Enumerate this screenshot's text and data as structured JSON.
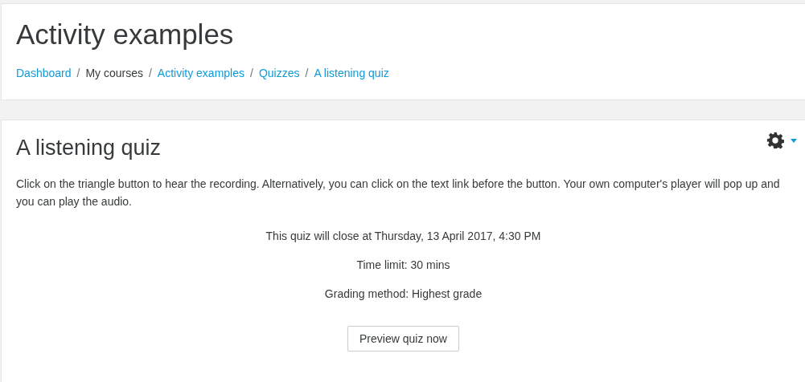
{
  "header": {
    "title": "Activity examples",
    "breadcrumb": [
      {
        "label": "Dashboard",
        "kind": "link"
      },
      {
        "label": "My courses",
        "kind": "text"
      },
      {
        "label": "Activity examples",
        "kind": "link"
      },
      {
        "label": "Quizzes",
        "kind": "link"
      },
      {
        "label": "A listening quiz",
        "kind": "link"
      }
    ],
    "separator": "/"
  },
  "activity": {
    "title": "A listening quiz",
    "intro": "Click on the triangle button to hear the recording. Alternatively, you can click on the text link before the button. Your own computer's player will pop up and you can play the audio.",
    "info": [
      "This quiz will close at Thursday, 13 April 2017, 4:30 PM",
      "Time limit: 30 mins",
      "Grading method: Highest grade"
    ],
    "button": "Preview quiz now"
  }
}
